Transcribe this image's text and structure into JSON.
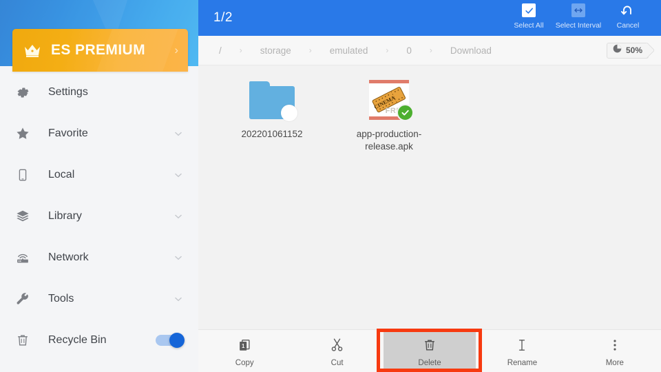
{
  "sidebar": {
    "premium": {
      "label": "ES PREMIUM",
      "icon": "crown-icon",
      "chevron": "›",
      "accent_start": "#f0a90e",
      "accent_end": "#fcb449"
    },
    "items": [
      {
        "label": "Settings",
        "icon": "gear-icon",
        "has_chevron": false,
        "has_toggle": false
      },
      {
        "label": "Favorite",
        "icon": "star-icon",
        "has_chevron": true,
        "has_toggle": false
      },
      {
        "label": "Local",
        "icon": "phone-icon",
        "has_chevron": true,
        "has_toggle": false
      },
      {
        "label": "Library",
        "icon": "layers-icon",
        "has_chevron": true,
        "has_toggle": false
      },
      {
        "label": "Network",
        "icon": "router-icon",
        "has_chevron": true,
        "has_toggle": false
      },
      {
        "label": "Tools",
        "icon": "wrench-icon",
        "has_chevron": true,
        "has_toggle": false
      },
      {
        "label": "Recycle Bin",
        "icon": "trash-icon",
        "has_chevron": false,
        "has_toggle": true,
        "toggle_state": "on"
      }
    ]
  },
  "topbar": {
    "selection_count": "1/2",
    "background": "#2979e8",
    "actions": [
      {
        "label": "Select All",
        "icon": "checkbox-checked-icon"
      },
      {
        "label": "Select Interval",
        "icon": "interval-arrows-icon"
      },
      {
        "label": "Cancel",
        "icon": "undo-arrow-icon"
      }
    ]
  },
  "breadcrumb": {
    "separator": "›",
    "crumbs": [
      "/",
      "storage",
      "emulated",
      "0",
      "Download"
    ],
    "storage": {
      "percent": "50%",
      "icon": "pie-chart-icon"
    }
  },
  "files": [
    {
      "name": "202201061152",
      "type": "folder",
      "icon": "folder-icon",
      "selected": false,
      "badge": "unselected-circle"
    },
    {
      "name": "app-production-release.apk",
      "type": "apk",
      "icon": "cinema-ticket-icon",
      "icon_text": "CINEMA",
      "icon_subtext": "FREE",
      "selected": true,
      "badge": "green-check"
    }
  ],
  "bottom_toolbar": {
    "tools": [
      {
        "label": "Copy",
        "icon": "copy-icon",
        "active": false
      },
      {
        "label": "Cut",
        "icon": "scissors-icon",
        "active": false
      },
      {
        "label": "Delete",
        "icon": "trash-icon",
        "active": true
      },
      {
        "label": "Rename",
        "icon": "text-cursor-icon",
        "active": false
      },
      {
        "label": "More",
        "icon": "more-vertical-icon",
        "active": false
      }
    ]
  },
  "highlight": {
    "target": "Delete",
    "color": "#f73a10"
  }
}
